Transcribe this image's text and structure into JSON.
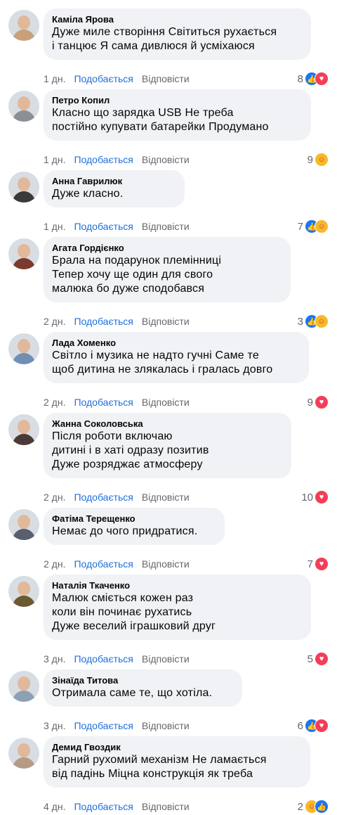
{
  "comments": [
    {
      "author": "Каміла Ярова",
      "lines": [
        "Дуже миле створіння Світиться рухається",
        "і танцює Я сама дивлюся й усміхаюся"
      ],
      "time": "1 дн.",
      "like": "Подобається",
      "reply": "Відповісти",
      "count": "8",
      "reactions": [
        "like",
        "heart"
      ],
      "avatar_color": "#c9a07a"
    },
    {
      "author": "Петро Копил",
      "lines": [
        "Класно що зарядка USB Не треба",
        "постійно купувати батарейки Продумано"
      ],
      "time": "1 дн.",
      "like": "Подобається",
      "reply": "Відповісти",
      "count": "9",
      "reactions": [
        "care"
      ],
      "avatar_color": "#8c8f96"
    },
    {
      "author": "Анна Гаврилюк",
      "lines": [
        "Дуже класно."
      ],
      "time": "1 дн.",
      "like": "Подобається",
      "reply": "Відповісти",
      "count": "7",
      "reactions": [
        "like",
        "care"
      ],
      "avatar_color": "#3a3a3a"
    },
    {
      "author": "Агата Гордієнко",
      "lines": [
        "Брала на подарунок племінниці",
        "Тепер хочу ще один для свого",
        "малюка бо дуже сподобався"
      ],
      "time": "2 дн.",
      "like": "Подобається",
      "reply": "Відповісти",
      "count": "3",
      "reactions": [
        "like",
        "care"
      ],
      "avatar_color": "#7a3b2e"
    },
    {
      "author": "Лада Хоменко",
      "lines": [
        "Світло і музика не надто гучні Саме те",
        "щоб дитина не злякалась і гралась довго"
      ],
      "time": "2 дн.",
      "like": "Подобається",
      "reply": "Відповісти",
      "count": "9",
      "reactions": [
        "heart"
      ],
      "avatar_color": "#6f8fb3"
    },
    {
      "author": "Жанна Соколовська",
      "lines": [
        "Після роботи включаю",
        "дитині і в хаті одразу позитив",
        "Дуже розряджає атмосферу"
      ],
      "time": "2 дн.",
      "like": "Подобається",
      "reply": "Відповісти",
      "count": "10",
      "reactions": [
        "heart"
      ],
      "avatar_color": "#4a3a35"
    },
    {
      "author": "Фатіма Терещенко",
      "lines": [
        "Немає до чого придратися."
      ],
      "time": "2 дн.",
      "like": "Подобається",
      "reply": "Відповісти",
      "count": "7",
      "reactions": [
        "heart"
      ],
      "avatar_color": "#5a5f6e"
    },
    {
      "author": "Наталія Ткаченко",
      "lines": [
        "Малюк сміється кожен раз",
        "коли він починає рухатись",
        "Дуже веселий іграшковий друг"
      ],
      "time": "3 дн.",
      "like": "Подобається",
      "reply": "Відповісти",
      "count": "5",
      "reactions": [
        "heart"
      ],
      "avatar_color": "#6b5a2f"
    },
    {
      "author": "Зінаїда Титова",
      "lines": [
        "Отримала саме те, що хотіла."
      ],
      "time": "3 дн.",
      "like": "Подобається",
      "reply": "Відповісти",
      "count": "6",
      "reactions": [
        "like",
        "heart"
      ],
      "avatar_color": "#8fa0b5"
    },
    {
      "author": "Демид Гвоздик",
      "lines": [
        "Гарний рухомий механізм Не ламається",
        "від падінь Міцна конструкція як треба"
      ],
      "time": "4 дн.",
      "like": "Подобається",
      "reply": "Відповісти",
      "count": "2",
      "reactions": [
        "care",
        "like"
      ],
      "avatar_color": "#b59a85"
    }
  ],
  "icons": {
    "like": "thumbs-up-icon",
    "heart": "heart-icon",
    "care": "care-icon"
  },
  "colors": {
    "bubble": "#f0f2f5",
    "like_link": "#216fdb",
    "muted": "#65676b",
    "like_reaction": "#1877f2",
    "heart_reaction": "#f33e58",
    "care_reaction": "#f7b928"
  }
}
